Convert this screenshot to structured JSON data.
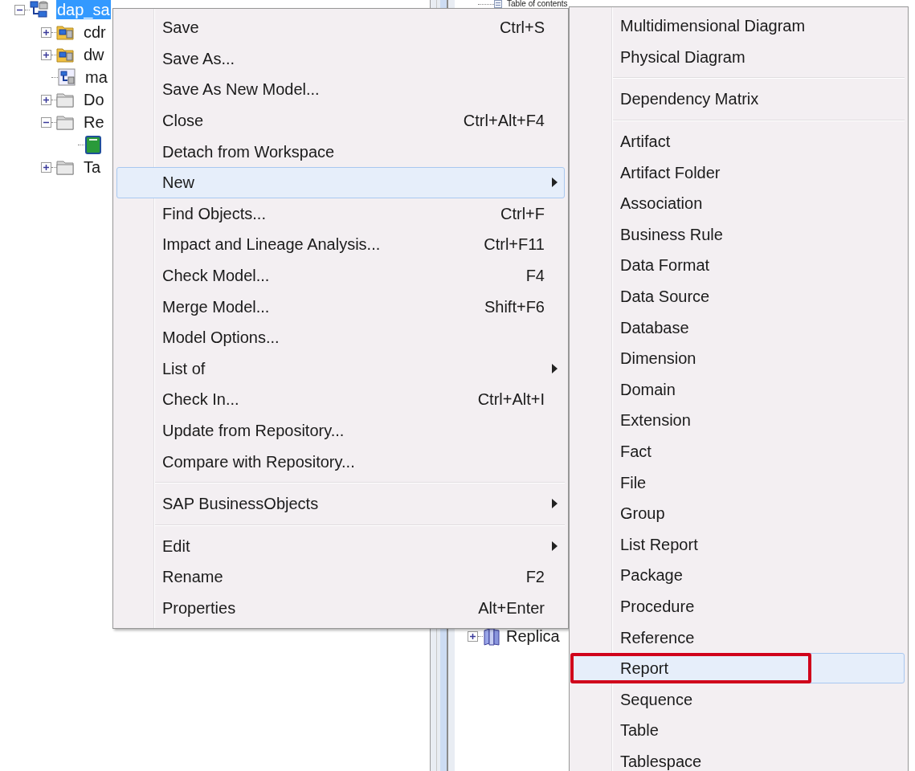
{
  "left_tree": {
    "items": [
      {
        "kind": "model",
        "label": "dap_sa",
        "selected": true,
        "expanded": true,
        "children": [
          {
            "kind": "package",
            "label": "cdr",
            "selected": false,
            "expanded": false
          },
          {
            "kind": "package",
            "label": "dw",
            "selected": false,
            "expanded": false
          },
          {
            "kind": "model-file",
            "label": "ma",
            "selected": false
          },
          {
            "kind": "folder",
            "label": "Do",
            "selected": false,
            "expanded": false
          },
          {
            "kind": "folder",
            "label": "Re",
            "selected": false,
            "expanded": true,
            "children": [
              {
                "kind": "book"
              }
            ]
          },
          {
            "kind": "folder",
            "label": "Ta",
            "selected": false,
            "expanded": false
          }
        ]
      }
    ]
  },
  "right_tree": {
    "items": [
      {
        "kind": "contents",
        "label": "Table of contents"
      },
      {
        "kind": "books",
        "label": "Replica",
        "expanded": false
      }
    ]
  },
  "context_menu": {
    "items": [
      {
        "kind": "item",
        "label": "Save",
        "shortcut": "Ctrl+S",
        "selected": false,
        "submenu": false
      },
      {
        "kind": "item",
        "label": "Save As...",
        "selected": false,
        "submenu": false
      },
      {
        "kind": "item",
        "label": "Save As New Model...",
        "selected": false,
        "submenu": false
      },
      {
        "kind": "item",
        "label": "Close",
        "shortcut": "Ctrl+Alt+F4",
        "selected": false,
        "submenu": false
      },
      {
        "kind": "item",
        "label": "Detach from Workspace",
        "selected": false,
        "submenu": false
      },
      {
        "kind": "item",
        "label": "New",
        "selected": true,
        "submenu": true
      },
      {
        "kind": "item",
        "label": "Find Objects...",
        "shortcut": "Ctrl+F",
        "selected": false,
        "submenu": false
      },
      {
        "kind": "item",
        "label": "Impact and Lineage Analysis...",
        "shortcut": "Ctrl+F11",
        "selected": false,
        "submenu": false
      },
      {
        "kind": "item",
        "label": "Check Model...",
        "shortcut": "F4",
        "selected": false,
        "submenu": false
      },
      {
        "kind": "item",
        "label": "Merge Model...",
        "shortcut": "Shift+F6",
        "selected": false,
        "submenu": false
      },
      {
        "kind": "item",
        "label": "Model Options...",
        "selected": false,
        "submenu": false
      },
      {
        "kind": "item",
        "label": "List of",
        "selected": false,
        "submenu": true
      },
      {
        "kind": "item",
        "label": "Check In...",
        "shortcut": "Ctrl+Alt+I",
        "selected": false,
        "submenu": false
      },
      {
        "kind": "item",
        "label": "Update from Repository...",
        "selected": false,
        "submenu": false
      },
      {
        "kind": "item",
        "label": "Compare with Repository...",
        "selected": false,
        "submenu": false
      },
      {
        "kind": "separator"
      },
      {
        "kind": "item",
        "label": "SAP BusinessObjects",
        "selected": false,
        "submenu": true
      },
      {
        "kind": "separator"
      },
      {
        "kind": "item",
        "label": "Edit",
        "selected": false,
        "submenu": true
      },
      {
        "kind": "item",
        "label": "Rename",
        "shortcut": "F2",
        "selected": false,
        "submenu": false
      },
      {
        "kind": "item",
        "label": "Properties",
        "shortcut": "Alt+Enter",
        "selected": false,
        "submenu": false
      }
    ]
  },
  "new_submenu": {
    "items": [
      {
        "kind": "item",
        "label": "Multidimensional Diagram",
        "selected": false,
        "outlined": false
      },
      {
        "kind": "item",
        "label": "Physical Diagram",
        "selected": false,
        "outlined": false
      },
      {
        "kind": "separator"
      },
      {
        "kind": "item",
        "label": "Dependency Matrix",
        "selected": false,
        "outlined": false
      },
      {
        "kind": "separator"
      },
      {
        "kind": "item",
        "label": "Artifact",
        "selected": false,
        "outlined": false
      },
      {
        "kind": "item",
        "label": "Artifact Folder",
        "selected": false,
        "outlined": false
      },
      {
        "kind": "item",
        "label": "Association",
        "selected": false,
        "outlined": false
      },
      {
        "kind": "item",
        "label": "Business Rule",
        "selected": false,
        "outlined": false
      },
      {
        "kind": "item",
        "label": "Data Format",
        "selected": false,
        "outlined": false
      },
      {
        "kind": "item",
        "label": "Data Source",
        "selected": false,
        "outlined": false
      },
      {
        "kind": "item",
        "label": "Database",
        "selected": false,
        "outlined": false
      },
      {
        "kind": "item",
        "label": "Dimension",
        "selected": false,
        "outlined": false
      },
      {
        "kind": "item",
        "label": "Domain",
        "selected": false,
        "outlined": false
      },
      {
        "kind": "item",
        "label": "Extension",
        "selected": false,
        "outlined": false
      },
      {
        "kind": "item",
        "label": "Fact",
        "selected": false,
        "outlined": false
      },
      {
        "kind": "item",
        "label": "File",
        "selected": false,
        "outlined": false
      },
      {
        "kind": "item",
        "label": "Group",
        "selected": false,
        "outlined": false
      },
      {
        "kind": "item",
        "label": "List Report",
        "selected": false,
        "outlined": false
      },
      {
        "kind": "item",
        "label": "Package",
        "selected": false,
        "outlined": false
      },
      {
        "kind": "item",
        "label": "Procedure",
        "selected": false,
        "outlined": false
      },
      {
        "kind": "item",
        "label": "Reference",
        "selected": false,
        "outlined": false
      },
      {
        "kind": "item",
        "label": "Report",
        "selected": true,
        "outlined": true
      },
      {
        "kind": "item",
        "label": "Sequence",
        "selected": false,
        "outlined": false
      },
      {
        "kind": "item",
        "label": "Table",
        "selected": false,
        "outlined": false
      },
      {
        "kind": "item",
        "label": "Tablespace",
        "selected": false,
        "outlined": false
      }
    ]
  }
}
